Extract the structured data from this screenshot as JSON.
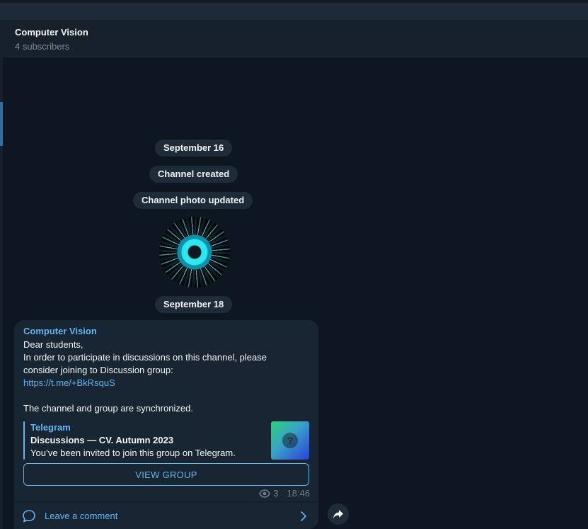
{
  "header": {
    "title": "Computer Vision",
    "subtitle": "4 subscribers"
  },
  "service": {
    "date1": "September 16",
    "created": "Channel created",
    "photo_updated": "Channel photo updated",
    "date2": "September 18"
  },
  "message": {
    "author": "Computer Vision",
    "lines": [
      "Dear students,",
      "In order to participate in discussions on this channel, please",
      "consider joining to Discussion group:"
    ],
    "link": "https://t.me/+BkRsquS",
    "line_after": "The channel and group are synchronized.",
    "preview": {
      "site": "Telegram",
      "title": "Discussions — CV. Autumn 2023",
      "description": "You’ve been invited to join this group on Telegram."
    },
    "button_label": "VIEW GROUP",
    "views": "3",
    "time": "18:46",
    "comment_label": "Leave a comment"
  },
  "colors": {
    "accent": "#64b5ef",
    "background": "#0e1621",
    "bubble": "#182533"
  },
  "icons": [
    "eye-icon",
    "comment-icon",
    "chevron-right-icon",
    "share-icon"
  ]
}
